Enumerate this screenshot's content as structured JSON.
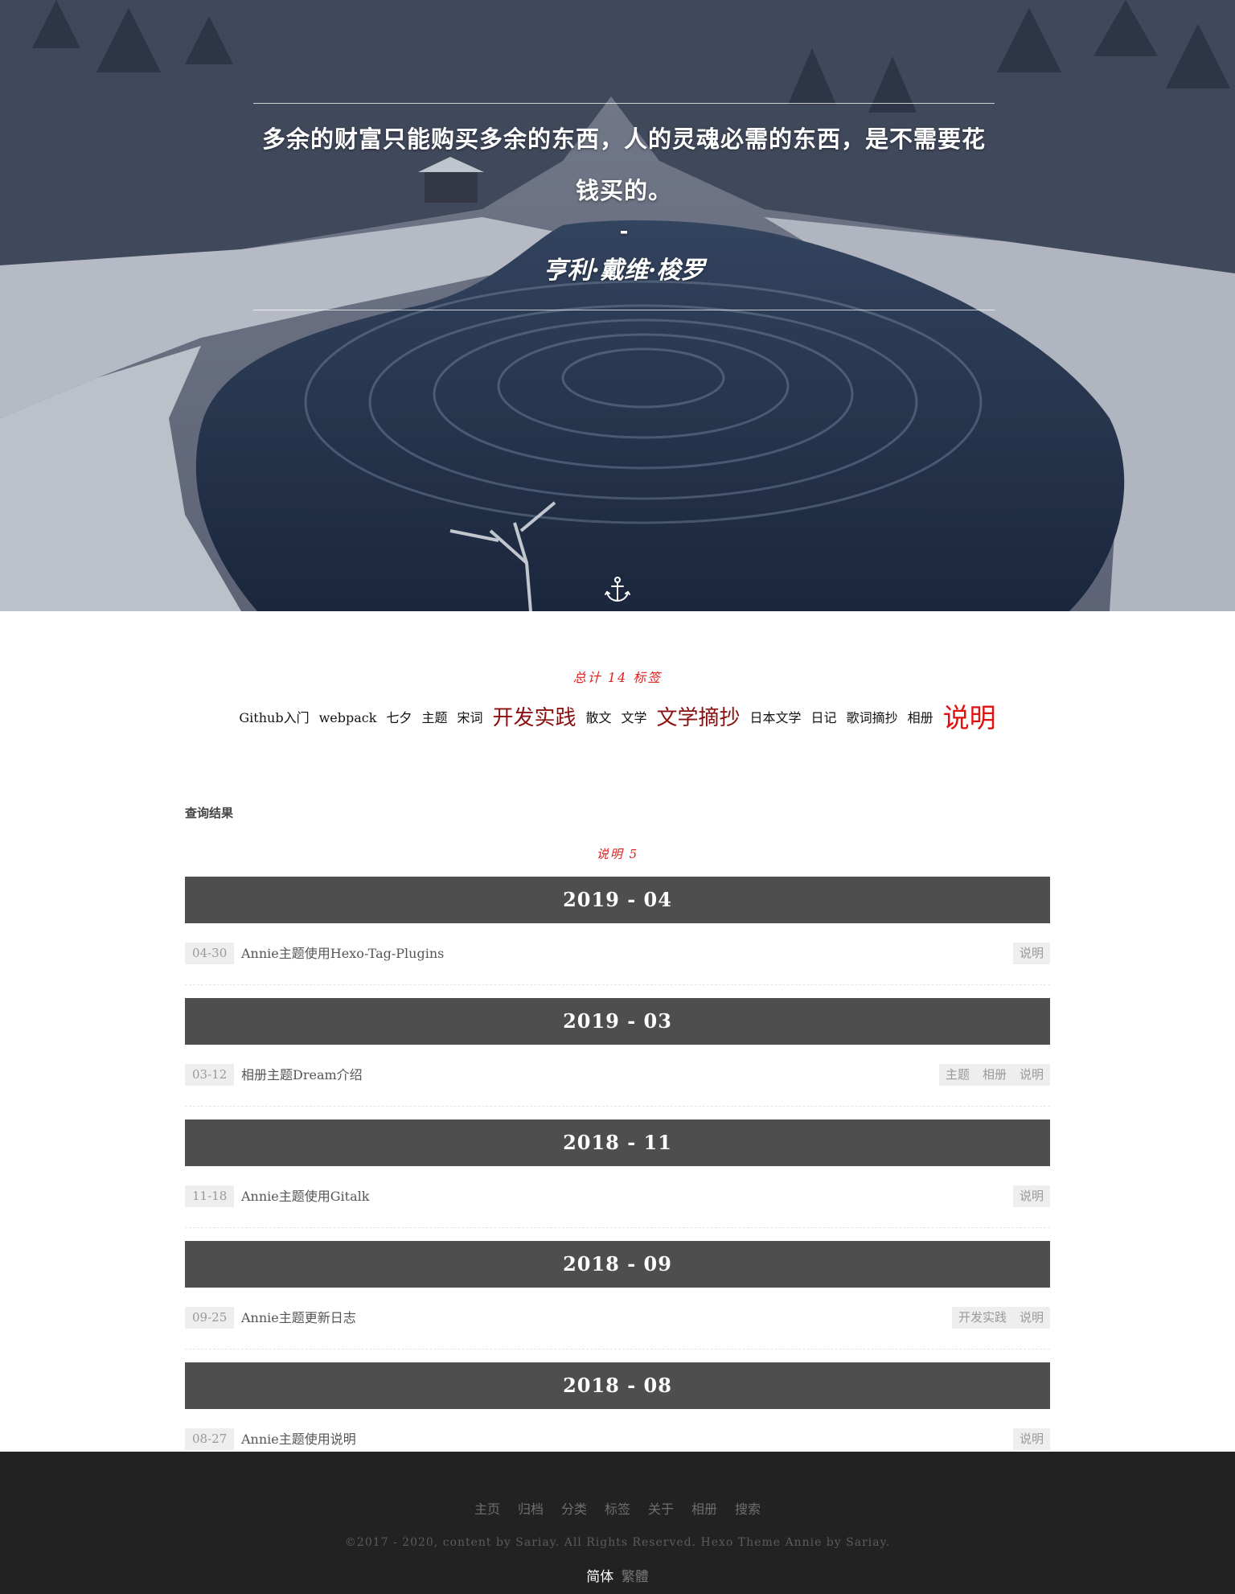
{
  "hero": {
    "quote": "多余的财富只能购买多余的东西，人的灵魂必需的东西，是不需要花钱买的。",
    "dash": "-",
    "author": "亨利·戴维·梭罗"
  },
  "tags": {
    "summary": "总计 14 标签",
    "items": [
      {
        "label": "Github入门",
        "size": "normal"
      },
      {
        "label": "webpack",
        "size": "normal"
      },
      {
        "label": "七夕",
        "size": "normal"
      },
      {
        "label": "主题",
        "size": "normal"
      },
      {
        "label": "宋词",
        "size": "normal"
      },
      {
        "label": "开发实践",
        "size": "big"
      },
      {
        "label": "散文",
        "size": "normal"
      },
      {
        "label": "文学",
        "size": "normal"
      },
      {
        "label": "文学摘抄",
        "size": "big"
      },
      {
        "label": "日本文学",
        "size": "normal"
      },
      {
        "label": "日记",
        "size": "normal"
      },
      {
        "label": "歌词摘抄",
        "size": "normal"
      },
      {
        "label": "相册",
        "size": "normal"
      },
      {
        "label": "说明",
        "size": "huge"
      }
    ]
  },
  "results": {
    "title": "查询结果",
    "subtitle": "说明 5",
    "groups": [
      {
        "month": "2019 - 04",
        "posts": [
          {
            "date": "04-30",
            "title": "Annie主题使用Hexo-Tag-Plugins",
            "tags": [
              "说明"
            ]
          }
        ]
      },
      {
        "month": "2019 - 03",
        "posts": [
          {
            "date": "03-12",
            "title": "相册主题Dream介绍",
            "tags": [
              "主题",
              "相册",
              "说明"
            ]
          }
        ]
      },
      {
        "month": "2018 - 11",
        "posts": [
          {
            "date": "11-18",
            "title": "Annie主题使用Gitalk",
            "tags": [
              "说明"
            ]
          }
        ]
      },
      {
        "month": "2018 - 09",
        "posts": [
          {
            "date": "09-25",
            "title": "Annie主题更新日志",
            "tags": [
              "开发实践",
              "说明"
            ]
          }
        ]
      },
      {
        "month": "2018 - 08",
        "posts": [
          {
            "date": "08-27",
            "title": "Annie主题使用说明",
            "tags": [
              "说明"
            ]
          }
        ]
      }
    ]
  },
  "footer": {
    "nav": [
      "主页",
      "归档",
      "分类",
      "标签",
      "关于",
      "相册",
      "搜索"
    ],
    "copyright": "©2017 - 2020, content by Sariay. All Rights Reserved. Hexo Theme Annie by Sariay.",
    "lang_active": "简体",
    "lang_inactive": "繁體"
  },
  "icons": {
    "scroll_down": "anchor-icon"
  },
  "colors": {
    "accent_red": "#e02020",
    "tag_big": "#8a1010",
    "month_bar": "#4e4e4e",
    "footer_bg": "#222222"
  }
}
